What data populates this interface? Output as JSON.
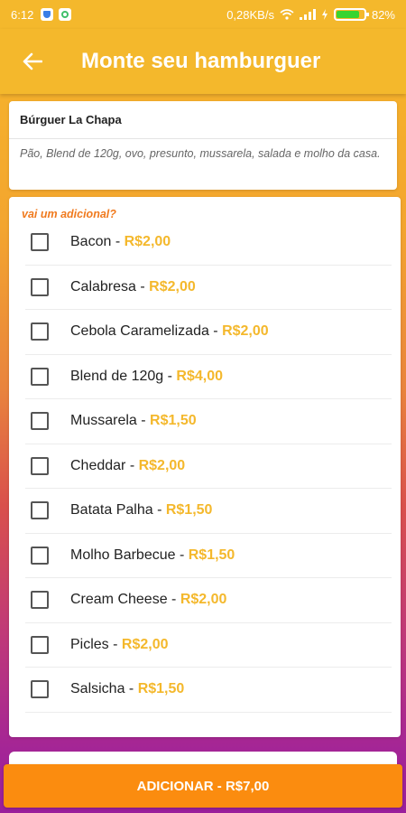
{
  "status_bar": {
    "time": "6:12",
    "network_speed": "0,28KB/s",
    "battery_percent": "82%",
    "battery_level": 0.82,
    "icons": [
      "shield-icon",
      "chat-icon",
      "wifi-icon",
      "signal-icon",
      "charging-icon",
      "battery-icon"
    ]
  },
  "app_bar": {
    "title": "Monte seu hamburguer",
    "back_icon": "arrow-left-icon"
  },
  "product": {
    "name": "Búrguer La Chapa",
    "description": "Pão, Blend de 120g, ovo, presunto, mussarela, salada e molho da casa."
  },
  "extras": {
    "title": "vai um adicional?",
    "items": [
      {
        "name": "Bacon",
        "sep": " - ",
        "price": "R$2,00"
      },
      {
        "name": "Calabresa",
        "sep": " - ",
        "price": "R$2,00"
      },
      {
        "name": "Cebola Caramelizada",
        "sep": " - ",
        "price": "R$2,00"
      },
      {
        "name": "Blend de 120g",
        "sep": " - ",
        "price": "R$4,00"
      },
      {
        "name": "Mussarela",
        "sep": " - ",
        "price": "R$1,50"
      },
      {
        "name": "Cheddar",
        "sep": " - ",
        "price": "R$2,00"
      },
      {
        "name": "Batata Palha",
        "sep": " - ",
        "price": "R$1,50"
      },
      {
        "name": "Molho Barbecue",
        "sep": " - ",
        "price": "R$1,50"
      },
      {
        "name": "Cream Cheese",
        "sep": " - ",
        "price": "R$2,00"
      },
      {
        "name": "Picles",
        "sep": " - ",
        "price": "R$2,00"
      },
      {
        "name": "Salsicha",
        "sep": " - ",
        "price": "R$1,50"
      }
    ]
  },
  "action": {
    "add_label": "ADICIONAR - R$7,00"
  },
  "colors": {
    "accent": "#f4b82c",
    "button": "#fb8c0f",
    "section_title": "#f07a1e"
  }
}
